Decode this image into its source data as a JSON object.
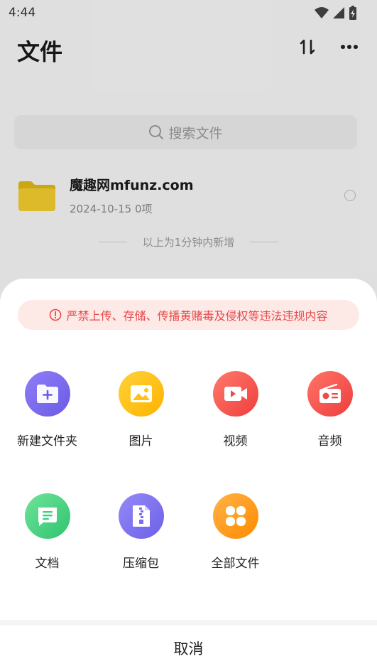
{
  "status": {
    "time": "4:44"
  },
  "header": {
    "title": "文件"
  },
  "search": {
    "placeholder": "搜索文件"
  },
  "file": {
    "name": "魔趣网mfunz.com",
    "meta": "2024-10-15  0项"
  },
  "note": "以上为1分钟内新增",
  "sheet": {
    "warning": "严禁上传、存储、传播黄赌毒及侵权等违法违规内容",
    "items": [
      {
        "label": "新建文件夹",
        "icon": "folder-add-icon",
        "color": "#7c6cf0"
      },
      {
        "label": "图片",
        "icon": "image-icon",
        "color": "#ffc21a"
      },
      {
        "label": "视频",
        "icon": "video-icon",
        "color": "#f5564f"
      },
      {
        "label": "音频",
        "icon": "radio-icon",
        "color": "#f45650"
      },
      {
        "label": "文档",
        "icon": "document-icon",
        "color": "#3cd27a"
      },
      {
        "label": "压缩包",
        "icon": "zip-icon",
        "color": "#7a6df0"
      },
      {
        "label": "全部文件",
        "icon": "grid-icon",
        "color": "#ff9a1f"
      }
    ],
    "cancel": "取消"
  }
}
